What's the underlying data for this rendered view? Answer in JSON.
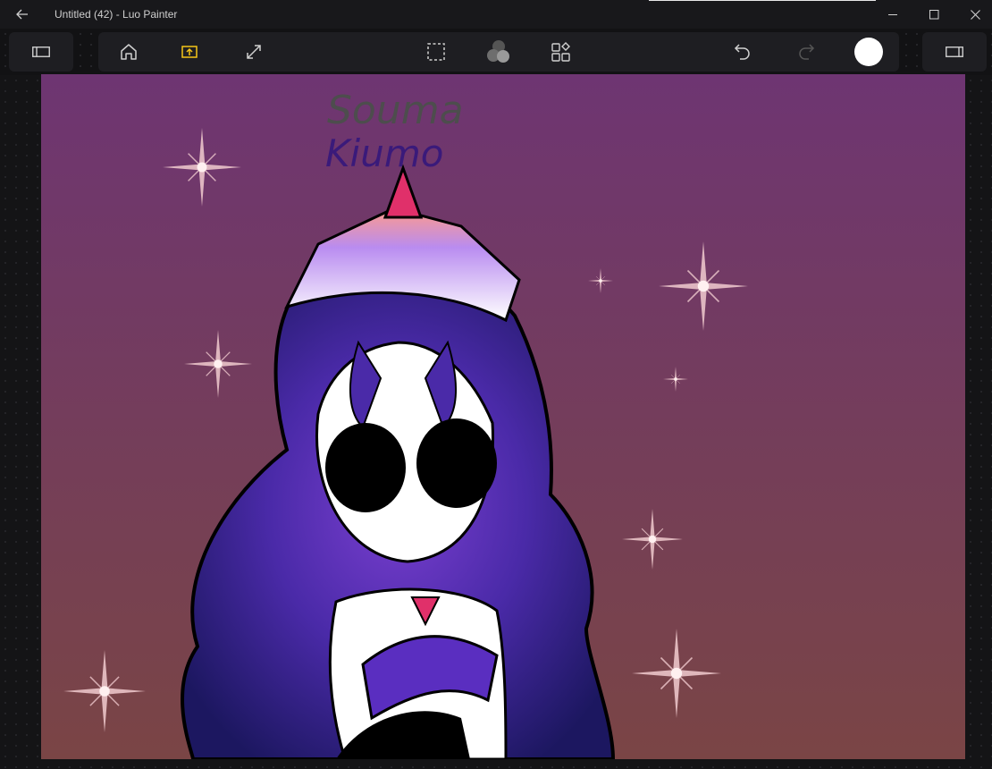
{
  "window": {
    "title": "Untitled (42) - Luo Painter",
    "back_icon": "arrow-left-icon",
    "minimize_icon": "minimize-icon",
    "maximize_icon": "maximize-icon",
    "close_icon": "close-icon"
  },
  "toolbar": {
    "left_panel_icon": "sidebar-left-icon",
    "home_icon": "home-icon",
    "export_icon": "export-icon",
    "fullscreen_icon": "expand-icon",
    "selection_icon": "selection-marquee-icon",
    "layers_blend_icon": "blend-circles-icon",
    "adjustments_icon": "shapes-grid-icon",
    "undo_icon": "undo-icon",
    "redo_icon": "redo-icon",
    "right_panel_icon": "sidebar-right-icon",
    "current_color": "#ffffff",
    "export_accent": "#f5c518"
  },
  "canvas": {
    "handwritten_text_line1": "Souma",
    "handwritten_text_line2": "Kiumo",
    "bg_top_color": "#6e3572",
    "bg_bottom_color": "#7a4545"
  }
}
